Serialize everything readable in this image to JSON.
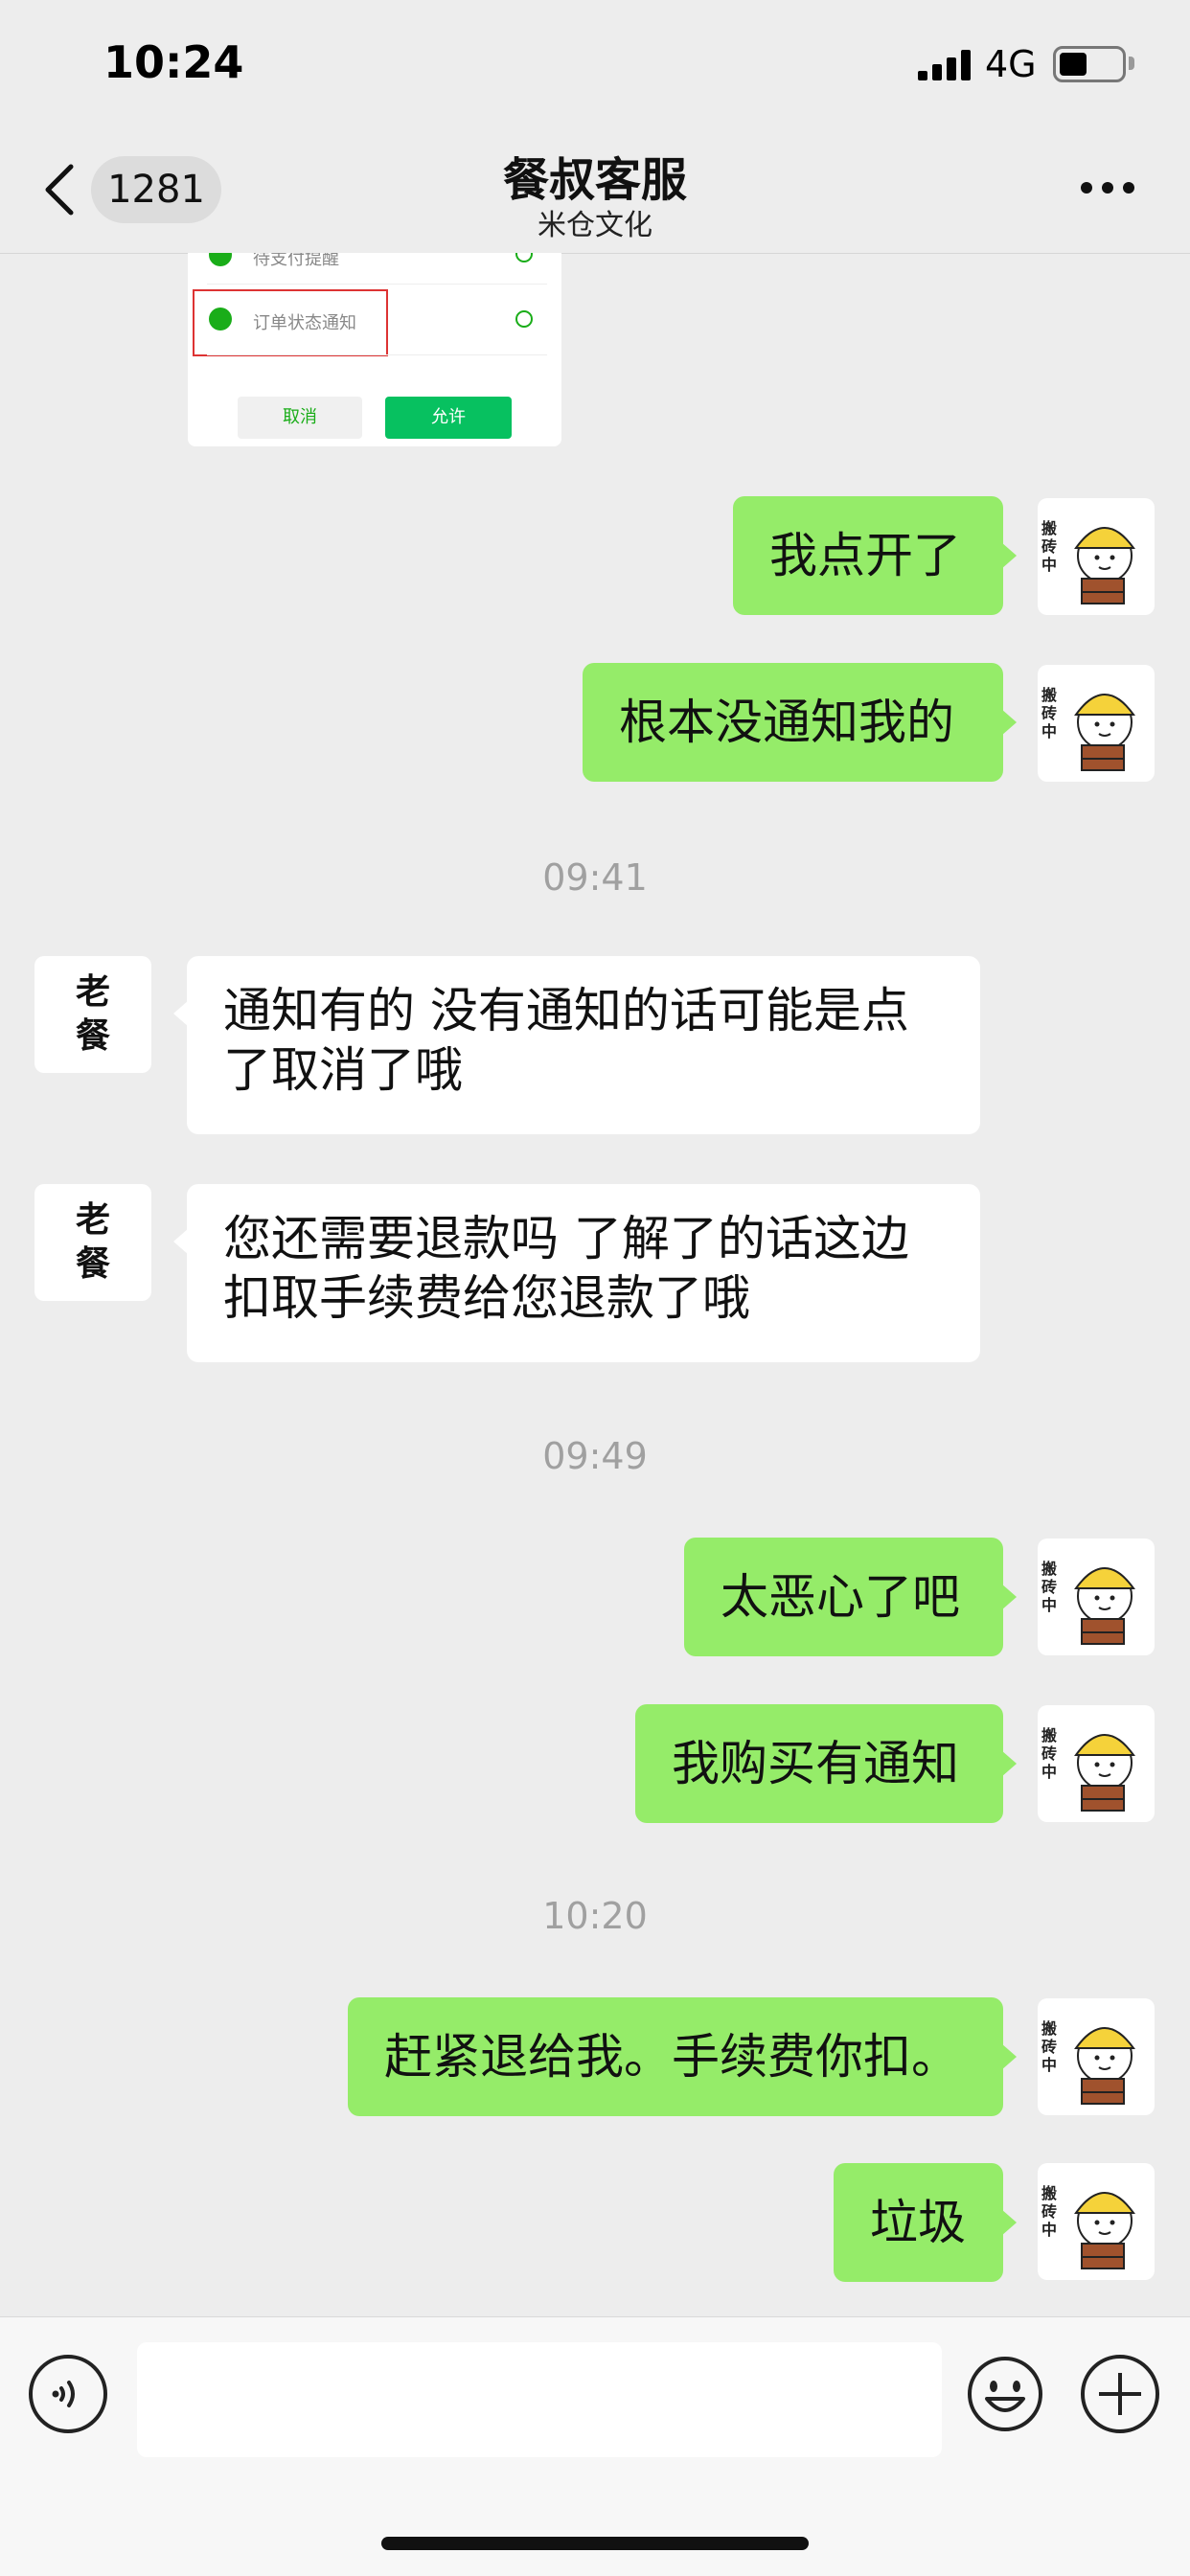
{
  "status_bar": {
    "time": "10:24",
    "network": "4G"
  },
  "nav": {
    "unread_count": "1281",
    "title": "餐叔客服",
    "subtitle": "米仓文化"
  },
  "permission_card": {
    "row1_label": "待支付提醒",
    "row2_label": "订单状态通知",
    "cancel_label": "取消",
    "allow_label": "允许"
  },
  "messages": [
    {
      "side": "out",
      "text": "我点开了"
    },
    {
      "side": "out",
      "text": "根本没通知我的"
    },
    {
      "side": "time",
      "text": "09:41"
    },
    {
      "side": "in",
      "line1": "通知有的  没有通知的话可能是点",
      "line2": "了取消了哦"
    },
    {
      "side": "in",
      "line1": "您还需要退款吗  了解了的话这边",
      "line2": "扣取手续费给您退款了哦"
    },
    {
      "side": "time",
      "text": "09:49"
    },
    {
      "side": "out",
      "text": "太恶心了吧"
    },
    {
      "side": "out",
      "text": "我购买有通知"
    },
    {
      "side": "time",
      "text": "10:20"
    },
    {
      "side": "out",
      "text": "赶紧退给我。手续费你扣。"
    },
    {
      "side": "out",
      "text": "垃圾"
    }
  ],
  "avatars": {
    "me_label": "搬砖中",
    "cs_label": "老餐"
  },
  "colors": {
    "outgoing_bubble": "#95ec69",
    "incoming_bubble": "#ffffff",
    "background": "#ededed",
    "accent_green": "#07c160"
  },
  "input_bar": {
    "placeholder": ""
  }
}
